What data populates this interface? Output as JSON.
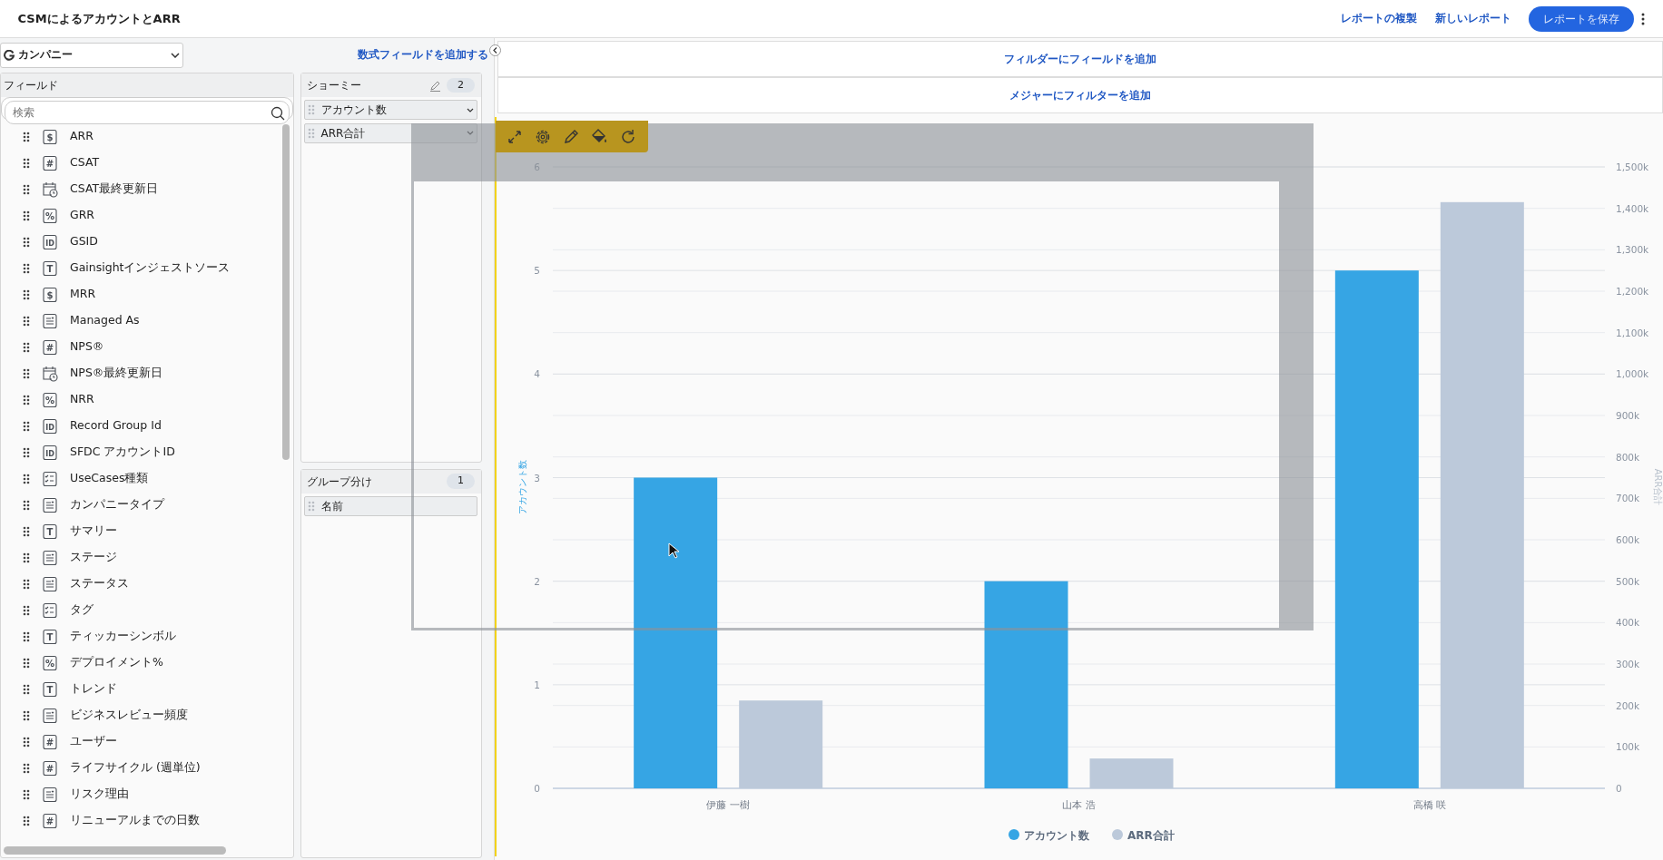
{
  "header": {
    "title": "CSMによるアカウントとARR",
    "actions": [
      {
        "label": "レポートの複製",
        "kind": "link"
      },
      {
        "label": "新しいレポート",
        "kind": "link"
      },
      {
        "label": "レポートを保存",
        "kind": "primary"
      }
    ]
  },
  "source_select": {
    "value": "カンパニー"
  },
  "formula_link": "数式フィールドを追加する",
  "fields_panel": {
    "title": "フィールド",
    "search": {
      "placeholder": "検索"
    },
    "items": [
      {
        "label": "ARR",
        "kind": "glyph",
        "glyph": "$"
      },
      {
        "label": "CSAT",
        "kind": "glyph",
        "glyph": "#"
      },
      {
        "label": "CSAT最終更新日",
        "kind": "date"
      },
      {
        "label": "GRR",
        "kind": "glyph",
        "glyph": "%"
      },
      {
        "label": "GSID",
        "kind": "glyph",
        "glyph": "ID"
      },
      {
        "label": "Gainsightインジェストソース",
        "kind": "glyph",
        "glyph": "T"
      },
      {
        "label": "MRR",
        "kind": "glyph",
        "glyph": "$"
      },
      {
        "label": "Managed As",
        "kind": "picklist"
      },
      {
        "label": "NPS®",
        "kind": "glyph",
        "glyph": "#"
      },
      {
        "label": "NPS®最終更新日",
        "kind": "date"
      },
      {
        "label": "NRR",
        "kind": "glyph",
        "glyph": "%"
      },
      {
        "label": "Record Group Id",
        "kind": "glyph",
        "glyph": "ID"
      },
      {
        "label": "SFDC アカウントID",
        "kind": "glyph",
        "glyph": "ID"
      },
      {
        "label": "UseCases種類",
        "kind": "multipicklist"
      },
      {
        "label": "カンパニータイプ",
        "kind": "picklist"
      },
      {
        "label": "サマリー",
        "kind": "glyph",
        "glyph": "T"
      },
      {
        "label": "ステージ",
        "kind": "picklist"
      },
      {
        "label": "ステータス",
        "kind": "picklist"
      },
      {
        "label": "タグ",
        "kind": "multipicklist"
      },
      {
        "label": "ティッカーシンボル",
        "kind": "glyph",
        "glyph": "T"
      },
      {
        "label": "デプロイメント%",
        "kind": "glyph",
        "glyph": "%"
      },
      {
        "label": "トレンド",
        "kind": "glyph",
        "glyph": "T"
      },
      {
        "label": "ビジネスレビュー頻度",
        "kind": "picklist"
      },
      {
        "label": "ユーザー",
        "kind": "glyph",
        "glyph": "#"
      },
      {
        "label": "ライフサイクル (週単位)",
        "kind": "glyph",
        "glyph": "#"
      },
      {
        "label": "リスク理由",
        "kind": "picklist"
      },
      {
        "label": "リニューアルまでの日数",
        "kind": "glyph",
        "glyph": "#"
      }
    ]
  },
  "show_me": {
    "title": "ショーミー",
    "count": "2",
    "items": [
      {
        "label": "アカウント数",
        "dropdown": true
      },
      {
        "label": "ARR合計",
        "dropdown": true
      }
    ]
  },
  "group_by": {
    "title": "グループ分け",
    "count": "1",
    "items": [
      {
        "label": "名前",
        "dropdown": false
      }
    ]
  },
  "filters": [
    "フィルダーにフィールドを追加",
    "メジャーにフィルターを追加"
  ],
  "chart": {
    "chart_data": {
      "type": "bar",
      "grid": true,
      "legend": "bottom",
      "ylabel": "アカウント数",
      "y2label": "ARR合計",
      "categories": [
        "伊藤 一樹",
        "山本 浩",
        "高橋 咲"
      ],
      "series": [
        {
          "name": "アカウント数",
          "color": "#36a5e4",
          "values": [
            3,
            2,
            5
          ]
        },
        {
          "name": "ARR合計",
          "color": "#bcc9da",
          "axis": "y2",
          "values": [
            212000,
            72000,
            1415000
          ]
        }
      ],
      "ylim": [
        0,
        6
      ],
      "yticks": [
        0,
        1,
        2,
        3,
        4,
        5,
        6
      ],
      "y2lim": [
        0,
        1500000
      ],
      "y2ticks": [
        {
          "value": 0,
          "label": "0"
        },
        {
          "value": 100000,
          "label": "100k"
        },
        {
          "value": 200000,
          "label": "200k"
        },
        {
          "value": 300000,
          "label": "300k"
        },
        {
          "value": 400000,
          "label": "400k"
        },
        {
          "value": 500000,
          "label": "500k"
        },
        {
          "value": 600000,
          "label": "600k"
        },
        {
          "value": 700000,
          "label": "700k"
        },
        {
          "value": 800000,
          "label": "800k"
        },
        {
          "value": 900000,
          "label": "900k"
        },
        {
          "value": 1000000,
          "label": "1,000k"
        },
        {
          "value": 1100000,
          "label": "1,100k"
        },
        {
          "value": 1200000,
          "label": "1,200k"
        },
        {
          "value": 1300000,
          "label": "1,300k"
        },
        {
          "value": 1400000,
          "label": "1,400k"
        },
        {
          "value": 1500000,
          "label": "1,500k"
        }
      ]
    }
  }
}
